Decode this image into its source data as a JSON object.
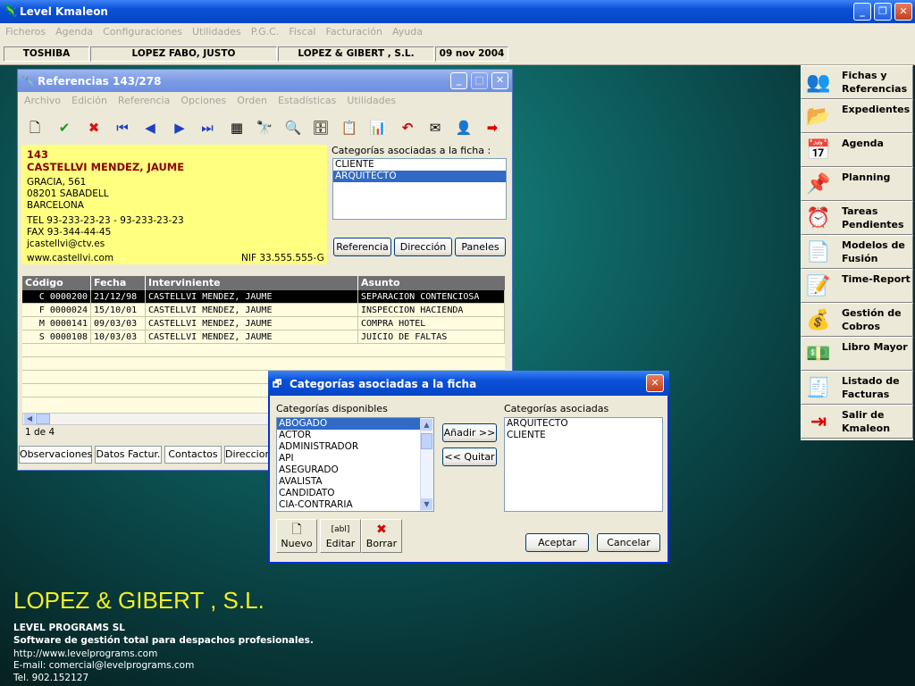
{
  "app": {
    "title": "Level Kmaleon",
    "min": "_",
    "max": "❐",
    "close": "✕"
  },
  "menu": [
    "Ficheros",
    "Agenda",
    "Configuraciones",
    "Utilidades",
    "P.G.C.",
    "Fiscal",
    "Facturación",
    "Ayuda"
  ],
  "info": {
    "machine": "TOSHIBA",
    "user": "LOPEZ FABO, JUSTO",
    "company": "LOPEZ & GIBERT , S.L.",
    "date": "09 nov 2004"
  },
  "sidebar": [
    {
      "label": "Fichas y Referencias",
      "icon": "people-icon",
      "glyph": "👥"
    },
    {
      "label": "Expedientes",
      "icon": "folder-icon",
      "glyph": "📂"
    },
    {
      "label": "Agenda",
      "icon": "calendar-icon",
      "glyph": "📅"
    },
    {
      "label": "Planning",
      "icon": "pushpin-icon",
      "glyph": "📌"
    },
    {
      "label": "Tareas Pendientes",
      "icon": "clock-icon",
      "glyph": "⏰"
    },
    {
      "label": "Modelos de Fusión",
      "icon": "document-merge-icon",
      "glyph": "📄"
    },
    {
      "label": "Time-Report",
      "icon": "timesheet-icon",
      "glyph": "📝"
    },
    {
      "label": "Gestión de Cobros",
      "icon": "coins-icon",
      "glyph": "💰"
    },
    {
      "label": "Libro Mayor",
      "icon": "ledger-icon",
      "glyph": "💵"
    },
    {
      "label": "Listado de Facturas",
      "icon": "invoice-list-icon",
      "glyph": "🧾"
    },
    {
      "label": "Salir de Kmaleon",
      "icon": "exit-icon",
      "glyph": "⇥"
    }
  ],
  "ref": {
    "title": "Referencias",
    "counter": "143/278",
    "menu": [
      "Archivo",
      "Edición",
      "Referencia",
      "Opciones",
      "Orden",
      "Estadísticas",
      "Utilidades"
    ],
    "card": {
      "code": "143",
      "name": "CASTELLVI MENDEZ, JAUME",
      "address": "GRACIA, 561",
      "city": "08201 SABADELL",
      "province": "BARCELONA",
      "tel": "TEL  93-233-23-23 - 93-233-23-23",
      "fax": "FAX  93-344-44-45",
      "email": "jcastellvi@ctv.es",
      "web": "www.castellvi.com",
      "nif": "NIF  33.555.555-G"
    },
    "categories_label": "Categorías asociadas a la ficha :",
    "categories": [
      "CLIENTE",
      "ARQUITECTO"
    ],
    "buttons": {
      "referencia": "Referencia",
      "direccion": "Dirección",
      "paneles": "Paneles"
    },
    "grid": {
      "columns": [
        "Código",
        "Fecha",
        "Interviniente",
        "Asunto"
      ],
      "rows": [
        [
          "C 0000200",
          "21/12/98",
          "CASTELLVI MENDEZ, JAUME",
          "SEPARACION CONTENCIOSA"
        ],
        [
          "F 0000024",
          "15/10/01",
          "CASTELLVI MENDEZ, JAUME",
          "INSPECCION HACIENDA"
        ],
        [
          "M 0000141",
          "09/03/03",
          "CASTELLVI MENDEZ, JAUME",
          "COMPRA HOTEL"
        ],
        [
          "S 0000108",
          "10/03/03",
          "CASTELLVI MENDEZ, JAUME",
          "JUICIO DE FALTAS"
        ]
      ]
    },
    "pager": "1 de 4",
    "tabs": [
      "Observaciones",
      "Datos Factur.",
      "Contactos",
      "Direccion"
    ]
  },
  "dialog": {
    "title": "Categorías asociadas a la ficha",
    "available_label": "Categorías disponibles",
    "associated_label": "Categorías asociadas",
    "available": [
      "ABOGADO",
      "ACTOR",
      "ADMINISTRADOR",
      "API",
      "ASEGURADO",
      "AVALISTA",
      "CANDIDATO",
      "CIA-CONTRARIA"
    ],
    "associated": [
      "ARQUITECTO",
      "CLIENTE"
    ],
    "add": "Añadir >>",
    "remove": "<< Quitar",
    "nuevo": "Nuevo",
    "editar": "Editar",
    "borrar": "Borrar",
    "aceptar": "Aceptar",
    "cancelar": "Cancelar"
  },
  "footer": {
    "company": "LOPEZ & GIBERT , S.L.",
    "vendor": "LEVEL PROGRAMS SL",
    "tagline": "Software de gestión total para despachos profesionales.",
    "url": "http://www.levelprograms.com",
    "email": "E-mail: comercial@levelprograms.com",
    "tel": "Tel. 902.152127"
  }
}
